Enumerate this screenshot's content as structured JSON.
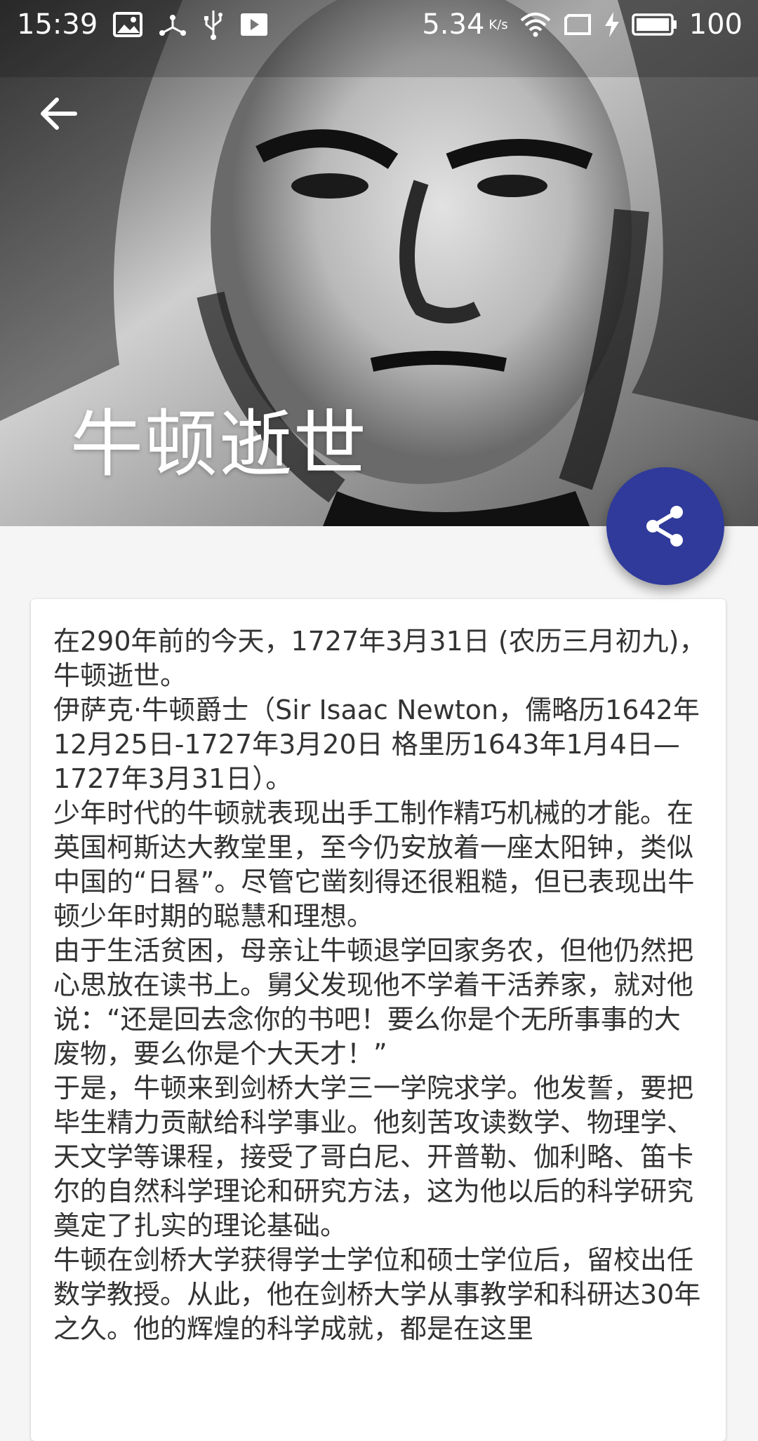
{
  "status_bar": {
    "time": "15:39",
    "net_speed": "5.34",
    "net_unit": "K/s",
    "battery": "100",
    "icons_left": [
      "image-icon",
      "usb-share-icon",
      "usb-icon",
      "play-icon"
    ],
    "icons_right": [
      "wifi-icon",
      "screen-icon",
      "charging-icon",
      "battery-icon"
    ]
  },
  "header": {
    "title": "牛顿逝世",
    "back_icon": "arrow-back-icon"
  },
  "fab": {
    "icon": "share-icon",
    "color": "#2f3a9b"
  },
  "article": {
    "paragraphs": [
      "在290年前的今天，1727年3月31日 (农历三月初九)，牛顿逝世。",
      "伊萨克·牛顿爵士（Sir Isaac Newton，儒略历1642年12月25日-1727年3月20日 格里历1643年1月4日—1727年3月31日）。",
      "少年时代的牛顿就表现出手工制作精巧机械的才能。在英国柯斯达大教堂里，至今仍安放着一座太阳钟，类似中国的“日晷”。尽管它凿刻得还很粗糙，但已表现出牛顿少年时期的聪慧和理想。",
      "由于生活贫困，母亲让牛顿退学回家务农，但他仍然把心思放在读书上。舅父发现他不学着干活养家，就对他说：“还是回去念你的书吧！要么你是个无所事事的大废物，要么你是个大天才！”",
      "于是，牛顿来到剑桥大学三一学院求学。他发誓，要把毕生精力贡献给科学事业。他刻苦攻读数学、物理学、天文学等课程，接受了哥白尼、开普勒、伽利略、笛卡尔的自然科学理论和研究方法，这为他以后的科学研究奠定了扎实的理论基础。",
      "牛顿在剑桥大学获得学士学位和硕士学位后，留校出任数学教授。从此，他在剑桥大学从事教学和科研达30年之久。他的辉煌的科学成就，都是在这里"
    ]
  }
}
